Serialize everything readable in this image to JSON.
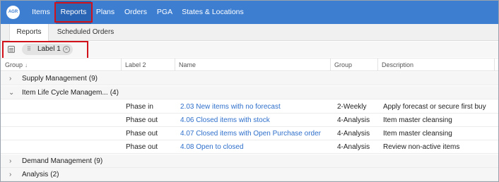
{
  "nav": {
    "logo": "AGR",
    "items": [
      {
        "label": "Items"
      },
      {
        "label": "Reports"
      },
      {
        "label": "Plans"
      },
      {
        "label": "Orders"
      },
      {
        "label": "PGA"
      },
      {
        "label": "States & Locations"
      }
    ],
    "active": "Reports"
  },
  "subtabs": [
    {
      "label": "Reports"
    },
    {
      "label": "Scheduled Orders"
    }
  ],
  "grouping": {
    "chip_label": "Label 1",
    "chip_close": "×"
  },
  "table": {
    "columns": [
      {
        "label": "Group"
      },
      {
        "label": "Label 2"
      },
      {
        "label": "Name"
      },
      {
        "label": "Group"
      },
      {
        "label": "Description"
      }
    ],
    "sort_icon": "↓",
    "groups": [
      {
        "title": "Supply Management",
        "count": "(9)",
        "expanded": false
      },
      {
        "title": "Item Life Cycle Managem...",
        "count": "(4)",
        "expanded": true
      },
      {
        "title": "Demand Management",
        "count": "(9)",
        "expanded": false
      },
      {
        "title": "Analysis",
        "count": "(2)",
        "expanded": false
      }
    ],
    "rows": [
      {
        "label2": "Phase in",
        "name": "2.03 New items with no forecast",
        "group": "2-Weekly",
        "description": "Apply forecast or secure first buy"
      },
      {
        "label2": "Phase out",
        "name": "4.06 Closed items with  stock",
        "group": "4-Analysis",
        "description": "Item master cleansing"
      },
      {
        "label2": "Phase out",
        "name": "4.07 Closed items with  Open Purchase order",
        "group": "4-Analysis",
        "description": "Item master cleansing"
      },
      {
        "label2": "Phase out",
        "name": "4.08 Open to closed",
        "group": "4-Analysis",
        "description": "Review non-active items"
      }
    ],
    "caret_collapsed": "›",
    "caret_expanded": "⌄"
  }
}
